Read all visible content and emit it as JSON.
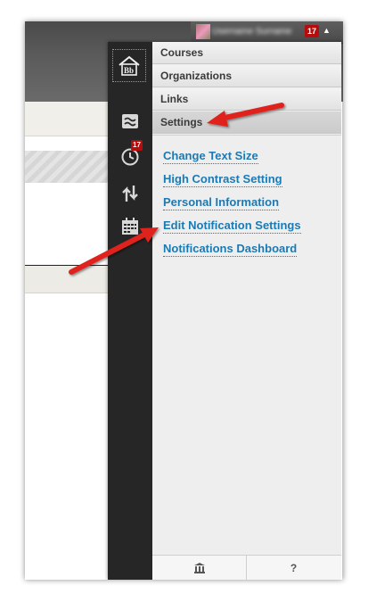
{
  "header": {
    "username": "Username Surname",
    "notification_count": "17"
  },
  "icon_bar": {
    "home_icon": "blackboard-home-icon",
    "stream_icon": "activity-stream-icon",
    "notifications_icon": "clock-icon",
    "notifications_count": "17",
    "updates_icon": "up-down-arrows-icon",
    "calendar_icon": "calendar-icon"
  },
  "menu": {
    "tabs": [
      {
        "label": "Courses"
      },
      {
        "label": "Organizations"
      },
      {
        "label": "Links"
      },
      {
        "label": "Settings"
      }
    ],
    "settings_links": [
      {
        "label": "Change Text Size"
      },
      {
        "label": "High Contrast Setting"
      },
      {
        "label": "Personal Information"
      },
      {
        "label": "Edit Notification Settings"
      },
      {
        "label": "Notifications Dashboard"
      }
    ],
    "footer": {
      "home_icon": "institution-icon",
      "help_label": "?"
    }
  },
  "colors": {
    "link": "#1c7ab3",
    "badge": "#b50d0d",
    "annotation_arrow": "#e0201b",
    "icon_bar": "#262626"
  }
}
